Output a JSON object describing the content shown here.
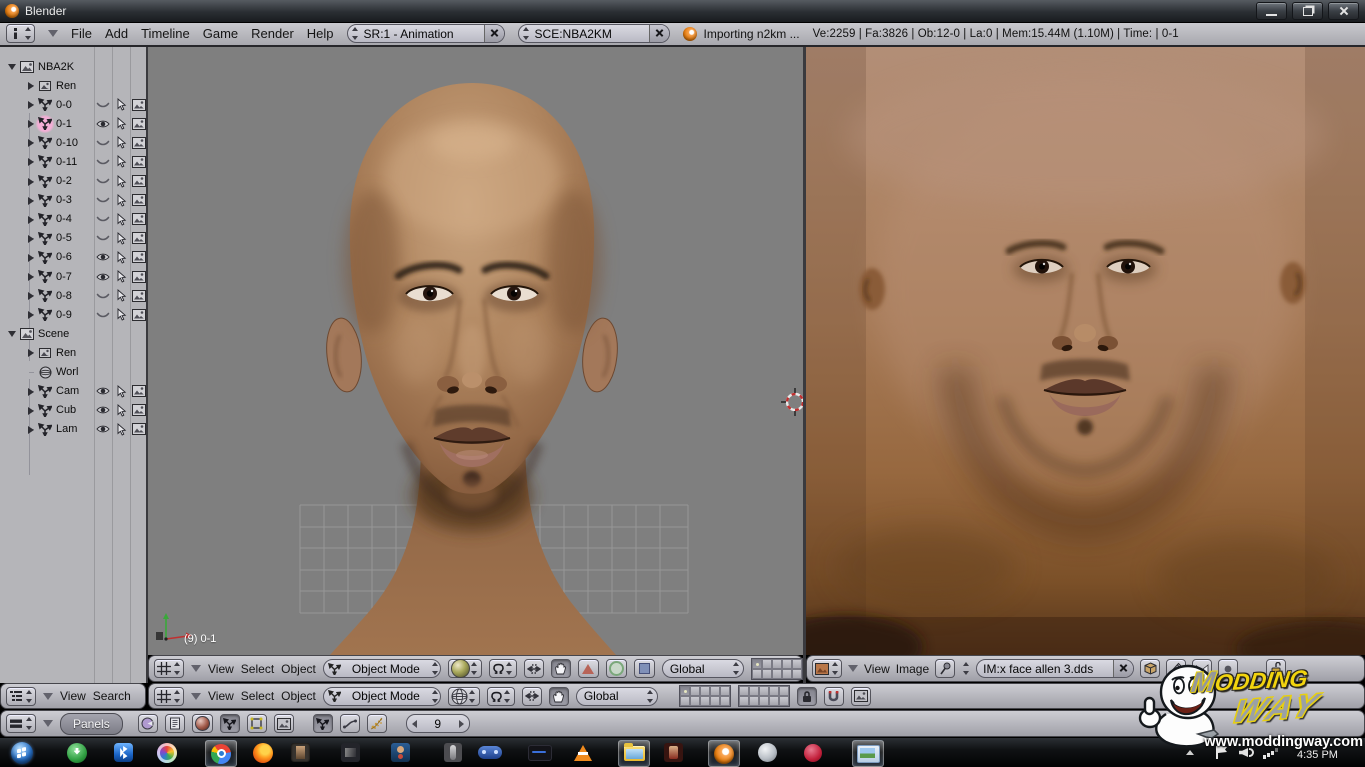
{
  "window": {
    "title": "Blender"
  },
  "top_header": {
    "menus": [
      "File",
      "Add",
      "Timeline",
      "Game",
      "Render",
      "Help"
    ],
    "screen_field": {
      "value": "SR:1 - Animation"
    },
    "scene_field": {
      "value": "SCE:NBA2KM"
    },
    "status": {
      "message": "Importing n2km ...",
      "stats": "Ve:2259 | Fa:3826 | Ob:12-0 | La:0  | Mem:15.44M (1.10M)  | Time: | 0-1"
    }
  },
  "outliner": {
    "header_menus": [
      "View",
      "Search"
    ],
    "items": [
      {
        "label": "NBA2K",
        "icon": "scene",
        "depth": 0,
        "expander": "expanded"
      },
      {
        "label": "Ren",
        "icon": "render",
        "depth": 1,
        "expander": "collapsed"
      },
      {
        "label": "0-0",
        "icon": "empty",
        "depth": 1,
        "expander": "collapsed",
        "eye": "closed",
        "cols": true
      },
      {
        "label": "0-1",
        "icon": "empty",
        "depth": 1,
        "expander": "collapsed",
        "eye": "open",
        "selected": true,
        "cols": true
      },
      {
        "label": "0-10",
        "icon": "empty",
        "depth": 1,
        "expander": "collapsed",
        "eye": "closed",
        "cols": true
      },
      {
        "label": "0-11",
        "icon": "empty",
        "depth": 1,
        "expander": "collapsed",
        "eye": "closed",
        "cols": true
      },
      {
        "label": "0-2",
        "icon": "empty",
        "depth": 1,
        "expander": "collapsed",
        "eye": "closed",
        "cols": true
      },
      {
        "label": "0-3",
        "icon": "empty",
        "depth": 1,
        "expander": "collapsed",
        "eye": "closed",
        "cols": true
      },
      {
        "label": "0-4",
        "icon": "empty",
        "depth": 1,
        "expander": "collapsed",
        "eye": "closed",
        "cols": true
      },
      {
        "label": "0-5",
        "icon": "empty",
        "depth": 1,
        "expander": "collapsed",
        "eye": "closed",
        "cols": true
      },
      {
        "label": "0-6",
        "icon": "empty",
        "depth": 1,
        "expander": "collapsed",
        "eye": "open",
        "cols": true
      },
      {
        "label": "0-7",
        "icon": "empty",
        "depth": 1,
        "expander": "collapsed",
        "eye": "open",
        "cols": true
      },
      {
        "label": "0-8",
        "icon": "empty",
        "depth": 1,
        "expander": "collapsed",
        "eye": "closed",
        "cols": true
      },
      {
        "label": "0-9",
        "icon": "empty",
        "depth": 1,
        "expander": "collapsed",
        "eye": "closed",
        "cols": true
      },
      {
        "label": "Scene",
        "icon": "scene",
        "depth": 0,
        "expander": "expanded"
      },
      {
        "label": "Ren",
        "icon": "render",
        "depth": 1,
        "expander": "collapsed"
      },
      {
        "label": "Worl",
        "icon": "world",
        "depth": 1,
        "expander": "none"
      },
      {
        "label": "Cam",
        "icon": "empty",
        "depth": 1,
        "expander": "collapsed",
        "eye": "open",
        "cols": true
      },
      {
        "label": "Cub",
        "icon": "empty",
        "depth": 1,
        "expander": "collapsed",
        "eye": "open",
        "cols": true
      },
      {
        "label": "Lam",
        "icon": "empty",
        "depth": 1,
        "expander": "collapsed",
        "eye": "open",
        "cols": true
      }
    ]
  },
  "viewport_3d": {
    "corner_label": "(9) 0-1",
    "header": {
      "menus": [
        "View",
        "Select",
        "Object"
      ],
      "mode": "Object Mode",
      "orientation": "Global"
    },
    "header_lower": {
      "menus": [
        "View",
        "Select",
        "Object"
      ],
      "mode": "Object Mode",
      "orientation": "Global"
    }
  },
  "uv_editor": {
    "header": {
      "menus": [
        "View",
        "Image"
      ],
      "image_name": "IM:x face allen 3.dds"
    }
  },
  "buttons_header": {
    "panels_label": "Panels",
    "frame": "9"
  },
  "taskbar": {
    "clock": "4:35 PM",
    "icons": [
      {
        "name": "start-orb"
      },
      {
        "name": "idm",
        "color": "#2f9e41"
      },
      {
        "name": "bluetooth",
        "color": "#1b66c9"
      },
      {
        "name": "media-player"
      },
      {
        "name": "chrome",
        "active": true
      },
      {
        "name": "firefox"
      },
      {
        "name": "photo-app-1"
      },
      {
        "name": "photo-app-2"
      },
      {
        "name": "person-app"
      },
      {
        "name": "statue-app"
      },
      {
        "name": "ps-controller"
      },
      {
        "name": "console-app"
      },
      {
        "name": "vlc"
      },
      {
        "name": "explorer-folder",
        "active": true
      },
      {
        "name": "game-app"
      },
      {
        "name": "blender",
        "active": true,
        "color": "#e87d0d"
      },
      {
        "name": "globe-app"
      },
      {
        "name": "nba-app",
        "color": "#c21f3a"
      },
      {
        "name": "image-viewer",
        "active": true
      }
    ]
  },
  "watermark": {
    "url": "www.moddingway.com",
    "logo_m": "M",
    "logo_odding": "ODDING",
    "logo_way": "WAY"
  },
  "accent_colors": {
    "blender_orange": "#e87d0d",
    "selection_pink": "#f4aed6",
    "viewport_gray": "#7f7f7f",
    "header_gray": "#b5b5b9"
  }
}
